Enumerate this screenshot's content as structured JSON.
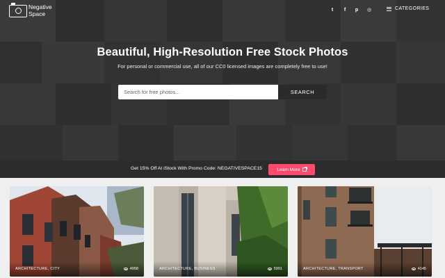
{
  "header": {
    "logo": {
      "line1": "Negative",
      "line2": "Space",
      "icon": "camera-logo-icon"
    },
    "social": [
      {
        "name": "twitter-icon",
        "glyph": "t"
      },
      {
        "name": "facebook-icon",
        "glyph": "f"
      },
      {
        "name": "pinterest-icon",
        "glyph": "p"
      },
      {
        "name": "instagram-icon",
        "glyph": "◎"
      }
    ],
    "categories_label": "CATEGORIES"
  },
  "hero": {
    "title": "Beautiful, High-Resolution Free Stock Photos",
    "subtitle": "For personal or commercial use, all of our CC0 licensed images are completely free to use!",
    "search": {
      "placeholder": "Search for free photos...",
      "value": "",
      "button_label": "SEARCH"
    }
  },
  "promo": {
    "text": "Get 15% Off At iStock With Promo Code: NEGATIVESPACE15",
    "button_label": "Learn More",
    "accent": "#ff4a6e"
  },
  "photos": [
    {
      "tags": "ARCHITECTURE, CITY",
      "views": "4958"
    },
    {
      "tags": "ARCHITECTURE, BUSINESS",
      "views": "5991"
    },
    {
      "tags": "ARCHITECTURE, TRANSPORT",
      "views": "4145"
    }
  ]
}
